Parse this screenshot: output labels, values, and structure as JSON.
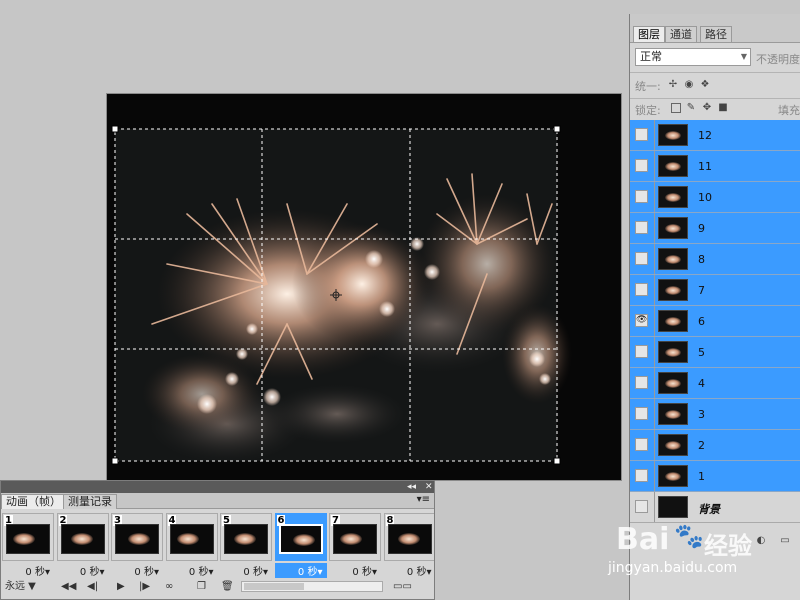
{
  "layers_panel": {
    "tabs": [
      "图层",
      "通道",
      "路径"
    ],
    "blend_mode": "正常",
    "opacity_label": "不透明度",
    "unify_label": "统一:",
    "lock_label": "锁定:",
    "fill_label": "填充",
    "layers": [
      {
        "name": "12",
        "visible": false,
        "selected": true
      },
      {
        "name": "11",
        "visible": false,
        "selected": true
      },
      {
        "name": "10",
        "visible": false,
        "selected": true
      },
      {
        "name": "9",
        "visible": false,
        "selected": true
      },
      {
        "name": "8",
        "visible": false,
        "selected": true
      },
      {
        "name": "7",
        "visible": false,
        "selected": true
      },
      {
        "name": "6",
        "visible": true,
        "selected": true
      },
      {
        "name": "5",
        "visible": false,
        "selected": true
      },
      {
        "name": "4",
        "visible": false,
        "selected": true
      },
      {
        "name": "3",
        "visible": false,
        "selected": true
      },
      {
        "name": "2",
        "visible": false,
        "selected": true
      },
      {
        "name": "1",
        "visible": false,
        "selected": true
      },
      {
        "name": "背景",
        "visible": false,
        "selected": false
      }
    ]
  },
  "animation_panel": {
    "tabs": [
      "动画（帧）",
      "测量记录"
    ],
    "loop": "永远",
    "frames": [
      {
        "number": "1",
        "delay": "0 秒",
        "selected": false
      },
      {
        "number": "2",
        "delay": "0 秒",
        "selected": false
      },
      {
        "number": "3",
        "delay": "0 秒",
        "selected": false
      },
      {
        "number": "4",
        "delay": "0 秒",
        "selected": false
      },
      {
        "number": "5",
        "delay": "0 秒",
        "selected": false
      },
      {
        "number": "6",
        "delay": "0 秒",
        "selected": true
      },
      {
        "number": "7",
        "delay": "0 秒",
        "selected": false
      },
      {
        "number": "8",
        "delay": "0 秒",
        "selected": false
      }
    ]
  },
  "watermark": {
    "brand_a": "Bai",
    "brand_b": "经验",
    "url": "jingyan.baidu.com"
  },
  "colors": {
    "selection_blue": "#3b9bff",
    "panel_gray": "#d6d6d6",
    "workspace_gray": "#c6c6c6"
  }
}
